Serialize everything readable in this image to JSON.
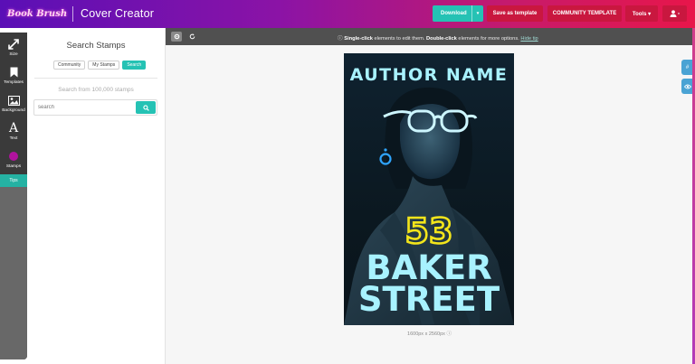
{
  "header": {
    "logo_text": "Book Brush",
    "app_title": "Cover Creator",
    "download_label": "Download",
    "save_template_label": "Save as template",
    "community_template_label": "COMMUNITY TEMPLATE",
    "tools_label": "Tools ▾",
    "user_icon": "user-icon"
  },
  "rail": {
    "items": [
      {
        "label": "Size",
        "icon": "resize-arrows-icon"
      },
      {
        "label": "Templates",
        "icon": "bookmark-icon"
      },
      {
        "label": "Background",
        "icon": "image-icon"
      },
      {
        "label": "Text",
        "icon": "text-a-icon"
      },
      {
        "label": "Stamps",
        "icon": "stamp-icon"
      }
    ],
    "tips_label": "Tips"
  },
  "panel": {
    "title": "Search Stamps",
    "tabs": [
      {
        "label": "Community",
        "active": false
      },
      {
        "label": "My Stamps",
        "active": false
      },
      {
        "label": "Search",
        "active": true
      }
    ],
    "hint": "Search from 100,000 stamps",
    "search_placeholder": "search"
  },
  "workspace": {
    "hint_bold_1": "Single-click",
    "hint_text_1": " elements to edit them. ",
    "hint_bold_2": "Double-click",
    "hint_text_2": " elements for more options. ",
    "hint_link": "Hide tip",
    "canvas_size": "1600px x 2560px",
    "side_tabs": [
      "#",
      "◎"
    ]
  },
  "cover": {
    "author": "AUTHOR NAME",
    "number": "53",
    "title_line1": "BAKER",
    "title_line2": "STREET"
  },
  "colors": {
    "accent_teal": "#25c2b4",
    "header_red": "#c9173f",
    "header_gradient_start": "#5a0fb6",
    "header_gradient_end": "#e8164a",
    "stamps_active": "#b1139e",
    "neon_yellow": "#f3e51b",
    "neon_cyan": "#a8f2ff"
  }
}
